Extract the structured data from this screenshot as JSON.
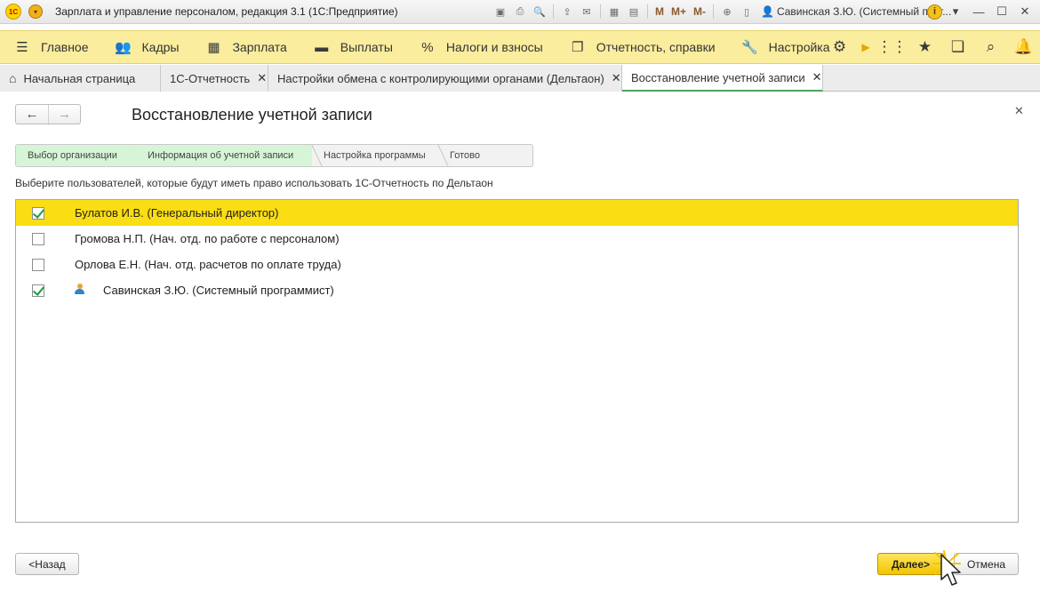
{
  "window": {
    "title": "Зарплата и управление персоналом, редакция 3.1  (1С:Предприятие)",
    "logo_text": "1С",
    "user": "Савинская З.Ю. (Системный прог...",
    "toolbar_marks": [
      "M",
      "M+",
      "M-"
    ]
  },
  "sections": [
    {
      "label": "Главное",
      "icon": "hamburger-icon",
      "glyph": "☰"
    },
    {
      "label": "Кадры",
      "icon": "people-icon",
      "glyph": "👥"
    },
    {
      "label": "Зарплата",
      "icon": "calculator-icon",
      "glyph": "▦"
    },
    {
      "label": "Выплаты",
      "icon": "wallet-icon",
      "glyph": "▬"
    },
    {
      "label": "Налоги и взносы",
      "icon": "percent-icon",
      "glyph": "%"
    },
    {
      "label": "Отчетность, справки",
      "icon": "documents-icon",
      "glyph": "❐"
    },
    {
      "label": "Настройка",
      "icon": "wrench-icon",
      "glyph": "🔧"
    }
  ],
  "tabs": [
    {
      "label": "Начальная страница",
      "closable": false
    },
    {
      "label": "1С-Отчетность",
      "closable": true
    },
    {
      "label": "Настройки обмена с контролирующими органами (Дельтаон)",
      "closable": true
    },
    {
      "label": "Восстановление учетной записи",
      "closable": true,
      "active": true
    }
  ],
  "form": {
    "title": "Восстановление учетной записи",
    "steps": [
      {
        "label": "Выбор организации",
        "done": true
      },
      {
        "label": "Информация об учетной записи",
        "done": true
      },
      {
        "label": "Настройка программы",
        "done": false
      },
      {
        "label": "Готово",
        "done": false
      }
    ],
    "hint": "Выберите пользователей, которые будут иметь право использовать 1С-Отчетность по Дельтаон",
    "users": [
      {
        "name": "Булатов И.В. (Генеральный директор)",
        "checked": true,
        "selected": true,
        "current_user": false
      },
      {
        "name": "Громова Н.П. (Нач. отд. по работе с персоналом)",
        "checked": false,
        "selected": false,
        "current_user": false
      },
      {
        "name": "Орлова Е.Н. (Нач. отд. расчетов по оплате труда)",
        "checked": false,
        "selected": false,
        "current_user": false
      },
      {
        "name": "Савинская З.Ю. (Системный программист)",
        "checked": true,
        "selected": false,
        "current_user": true
      }
    ],
    "buttons": {
      "back": "<Назад",
      "next": "Далее>",
      "cancel": "Отмена"
    }
  },
  "colors": {
    "sections_bar": "#fbed9e",
    "selected_row": "#fbdd13",
    "done_step": "#d6f5d6",
    "next_button": "#f2c500"
  }
}
